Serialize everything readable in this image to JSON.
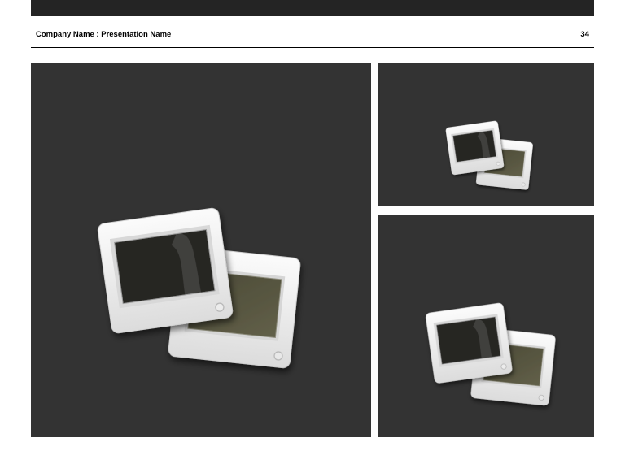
{
  "header": {
    "title": "Company Name : Presentation Name",
    "page_number": "34"
  },
  "colors": {
    "topbar": "#242424",
    "panel_background": "#333333",
    "slide_frame": "#f2f2f2",
    "slide_window_dark": "#252422",
    "slide_window_olive": "#55533f"
  },
  "panels": [
    {
      "name": "main-image-panel",
      "icon": "photo-slides-icon"
    },
    {
      "name": "top-right-image-panel",
      "icon": "photo-slides-icon"
    },
    {
      "name": "bottom-right-image-panel",
      "icon": "photo-slides-icon"
    }
  ]
}
